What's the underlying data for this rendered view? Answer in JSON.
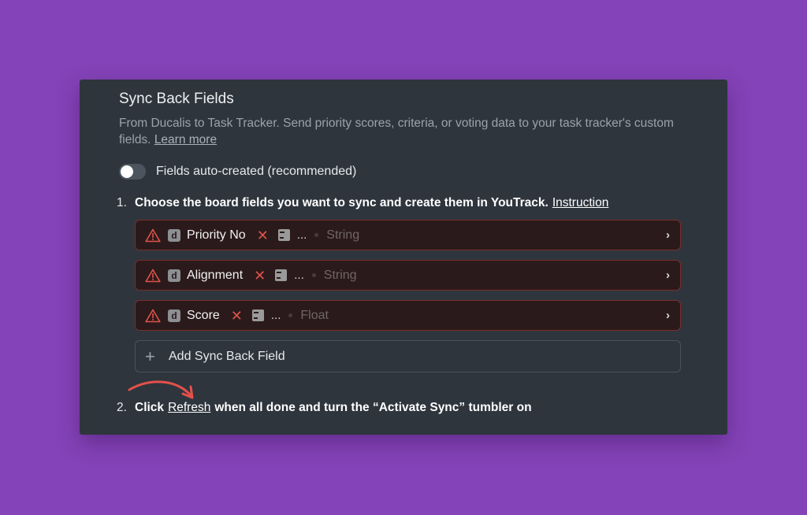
{
  "panel": {
    "title": "Sync Back Fields",
    "description": "From Ducalis to Task Tracker. Send priority scores, criteria, or voting data to your task tracker's custom fields.",
    "learn_more": "Learn more"
  },
  "toggle": {
    "label": "Fields auto-created (recommended)",
    "state": "off"
  },
  "step1": {
    "number": "1.",
    "text": "Choose the board fields you want to sync and create them in YouTrack.",
    "link": "Instruction"
  },
  "fields": [
    {
      "badge": "d",
      "name": "Priority No",
      "ellipsis": "...",
      "type": "String"
    },
    {
      "badge": "d",
      "name": "Alignment",
      "ellipsis": "...",
      "type": "String"
    },
    {
      "badge": "d",
      "name": "Score",
      "ellipsis": "...",
      "type": "Float"
    }
  ],
  "add_field": {
    "label": "Add Sync Back Field"
  },
  "step2": {
    "number": "2.",
    "prefix": "Click",
    "link": "Refresh",
    "suffix": "when all done and turn the “Activate Sync” tumbler on"
  },
  "colors": {
    "background": "#8443b8",
    "panel": "#2e353d",
    "error_border": "#7a2f2a",
    "error_icon": "#e0534a",
    "annotation_arrow": "#e5504a"
  }
}
